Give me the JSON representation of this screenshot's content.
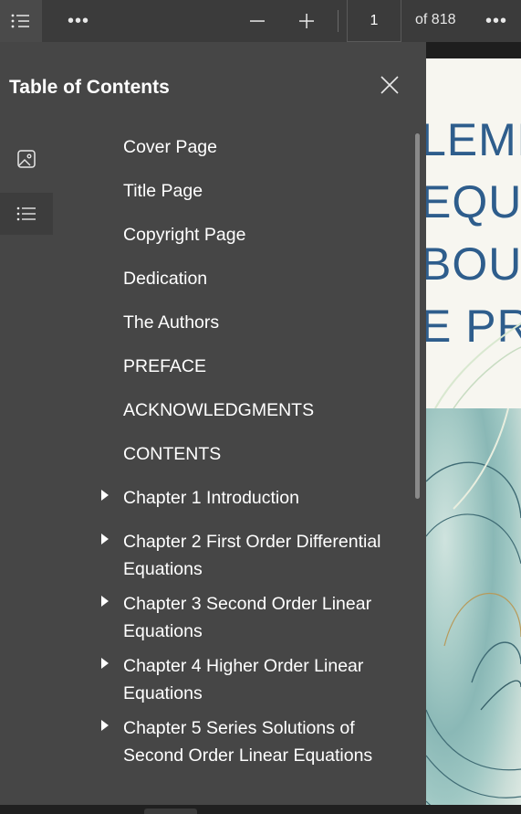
{
  "toolbar": {
    "toc_icon": "table-of-contents-icon",
    "more_label": "•••",
    "zoom_out_icon": "minus-icon",
    "zoom_in_icon": "plus-icon",
    "page_number": "1",
    "page_total": "of 818",
    "more_right_label": "•••"
  },
  "sidebar": {
    "title": "Table of Contents",
    "close_icon": "close-icon",
    "tabs": [
      {
        "icon": "image-thumbnails-icon"
      },
      {
        "icon": "list-icon"
      }
    ],
    "items": [
      {
        "label": "Cover Page",
        "expandable": false
      },
      {
        "label": "Title Page",
        "expandable": false
      },
      {
        "label": "Copyright Page",
        "expandable": false
      },
      {
        "label": "Dedication",
        "expandable": false
      },
      {
        "label": "The Authors",
        "expandable": false
      },
      {
        "label": "PREFACE",
        "expandable": false
      },
      {
        "label": "ACKNOWLEDGMENTS",
        "expandable": false
      },
      {
        "label": "CONTENTS",
        "expandable": false
      },
      {
        "label": "Chapter 1 Introduction",
        "expandable": true
      },
      {
        "label": "Chapter 2 First Order Differential Equations",
        "expandable": true
      },
      {
        "label": "Chapter 3 Second Order Linear Equations",
        "expandable": true
      },
      {
        "label": "Chapter 4 Higher Order Linear Equations",
        "expandable": true
      },
      {
        "label": "Chapter 5 Series Solutions of Second Order Linear Equations",
        "expandable": true
      }
    ]
  },
  "document": {
    "cover_lines": [
      "LEME",
      "EQUA",
      "BOU",
      "E PRO"
    ]
  },
  "colors": {
    "toolbar_bg": "#3b3b3b",
    "sidebar_bg": "#464646",
    "cover_text": "#2e5d8c"
  }
}
